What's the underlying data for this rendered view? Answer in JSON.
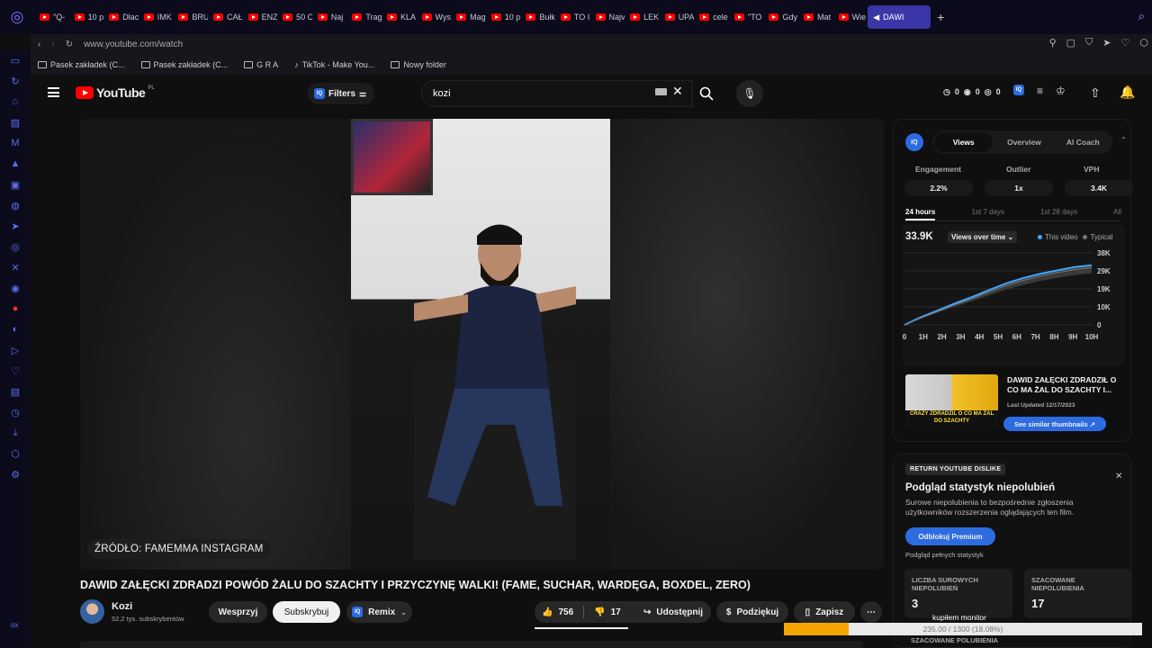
{
  "browser": {
    "tabs": [
      "\"Q-",
      "10 p",
      "Dlac",
      "IMK",
      "BRU",
      "CAŁ",
      "ENZ",
      "50 C",
      "Naj",
      "Trag",
      "KLA",
      "Wys",
      "Mag",
      "10 p",
      "Bułk",
      "TO I",
      "Najv",
      "LEK",
      "UPA",
      "cele",
      "\"TO",
      "Gdy",
      "Mat",
      "Wie"
    ],
    "active_tab": "DAWI",
    "url": "www.youtube.com/watch",
    "bookmarks": [
      "Pasek zakładek (C...",
      "Pasek zakładek (C...",
      "G R A",
      "TikTok - Make You...",
      "Nowy folder"
    ]
  },
  "masthead": {
    "logo": "YouTube",
    "region": "PL",
    "filters": "Filters",
    "search_value": "kozi",
    "counters": [
      "0",
      "0",
      "0"
    ]
  },
  "video": {
    "source_label": "ŹRÓDŁO: FAMEMMA INSTAGRAM",
    "title": "DAWID ZAŁĘCKI ZDRADZI POWÓD ŻALU DO SZACHTY I PRZYCZYNĘ WALKI! (FAME, SUCHAR, WARDĘGA, BOXDEL, ZERO)",
    "channel": "Kozi",
    "subscribers": "52,2 tys. subskrybentów",
    "support": "Wesprzyj",
    "subscribe": "Subskrybuj",
    "remix": "Remix",
    "likes": "756",
    "dislikes": "17",
    "share": "Udostępnij",
    "thanks": "Podziękuj",
    "save": "Zapisz"
  },
  "iq": {
    "badge": "IQ",
    "tabs": [
      "Views",
      "Overview",
      "AI Coach"
    ],
    "metrics": [
      {
        "label": "Engagement",
        "value": "2.2%"
      },
      {
        "label": "Outlier",
        "value": "1x"
      },
      {
        "label": "VPH",
        "value": "3.4K"
      }
    ],
    "ranges": [
      "24 hours",
      "1st 7 days",
      "1st 28 days",
      "All"
    ],
    "total": "33.9K",
    "chart_selector": "Views over time",
    "legend": [
      "This video",
      "Typical"
    ],
    "thumb_caption": "CRAZY ZDRADZIL O CO MA ŻAL DO SZACHTY",
    "related_title": "DAWID ZAŁĘCKI ZDRADZIŁ O CO MA ŻAL DO SZACHTY I...",
    "updated": "Last Updated 12/17/2023",
    "similar": "See similar thumbnails"
  },
  "chart_data": {
    "type": "line",
    "x": [
      "0",
      "1H",
      "2H",
      "3H",
      "4H",
      "5H",
      "6H",
      "7H",
      "8H",
      "9H",
      "10H"
    ],
    "y_ticks": [
      "38K",
      "29K",
      "19K",
      "10K",
      "0"
    ],
    "ylim": [
      0,
      38000
    ],
    "series": [
      {
        "name": "This video",
        "color": "#3ea6ff",
        "values": [
          0,
          4200,
          7800,
          11500,
          14800,
          18500,
          22000,
          24800,
          27000,
          28800,
          30500,
          31500
        ]
      },
      {
        "name": "Typical",
        "color": "#777777",
        "values": [
          0,
          3800,
          7300,
          10800,
          14000,
          17500,
          20800,
          23500,
          25800,
          27600,
          29200,
          30200
        ]
      }
    ]
  },
  "dislike": {
    "badge": "RETURN YOUTUBE DISLIKE",
    "title": "Podgląd statystyk niepolubień",
    "desc": "Surowe niepolubienia to bezpośrednie zgłoszenia użytkowników rozszerzenia oglądających ten film.",
    "unlock": "Odblokuj Premium",
    "full": "Podgląd pełnych statystyk",
    "raw_label": "LICZBA SUROWYCH NIEPOLUBIEŃ",
    "raw_value": "3",
    "est_label": "SZACOWANE NIEPOLUBIENIA",
    "est_value": "17",
    "est_likes_label": "SZACOWANE POLUBIENIA"
  },
  "overlay": {
    "title": "kupiłem monitor",
    "progress_text": "235.00 / 1300 (18.08%)",
    "progress": 0.1808
  }
}
